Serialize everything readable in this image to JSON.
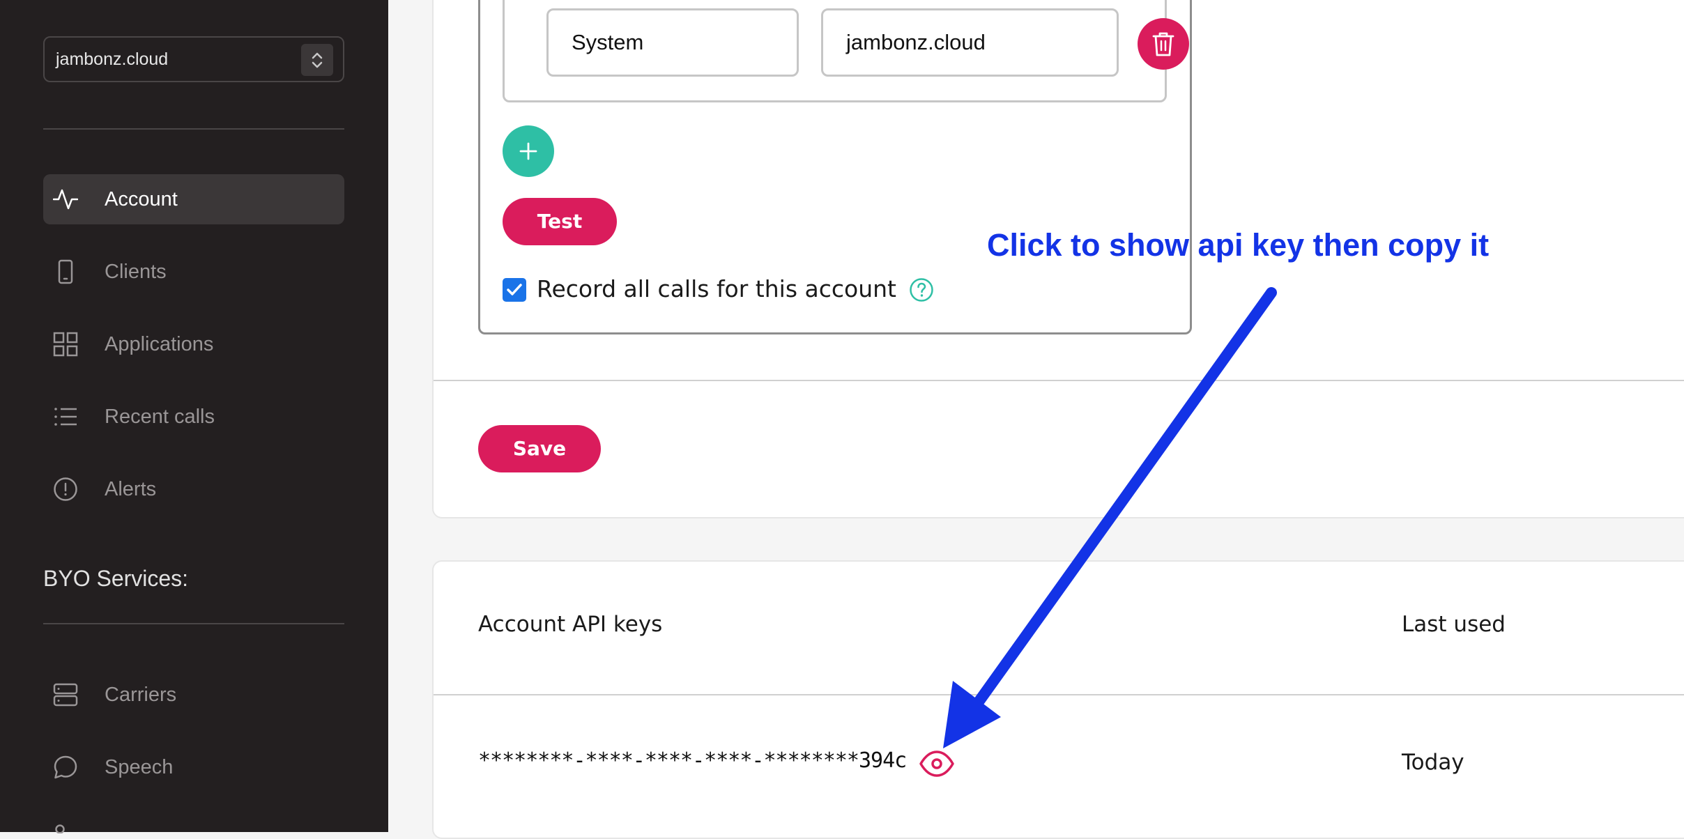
{
  "sidebar": {
    "account_selector": {
      "value": "jambonz.cloud"
    },
    "nav_items": [
      {
        "label": "Account",
        "icon": "activity-icon",
        "active": true
      },
      {
        "label": "Clients",
        "icon": "phone-device-icon",
        "active": false
      },
      {
        "label": "Applications",
        "icon": "grid-icon",
        "active": false
      },
      {
        "label": "Recent calls",
        "icon": "list-icon",
        "active": false
      },
      {
        "label": "Alerts",
        "icon": "alert-circle-icon",
        "active": false
      }
    ],
    "byo_section_label": "BYO Services:",
    "byo_items": [
      {
        "label": "Carriers",
        "icon": "server-icon"
      },
      {
        "label": "Speech",
        "icon": "chat-bubble-icon"
      }
    ]
  },
  "form": {
    "row_fields": {
      "system": "System",
      "domain": "jambonz.cloud"
    },
    "test_label": "Test",
    "record_calls": {
      "label": "Record all calls for this account",
      "checked": true
    },
    "save_label": "Save"
  },
  "api_keys": {
    "column_key": "Account API keys",
    "column_last_used": "Last used",
    "rows": [
      {
        "key": "********-****-****-****-********394c",
        "last_used": "Today"
      }
    ]
  },
  "annotation": {
    "text": "Click to show api key then copy it",
    "color": "#1333e6"
  },
  "colors": {
    "sidebar_bg": "#231f20",
    "brand_pink": "#da1c5c",
    "teal": "#2ebfa5",
    "checkbox_blue": "#1a73e8"
  }
}
